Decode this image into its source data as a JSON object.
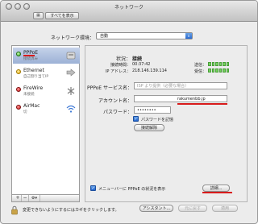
{
  "window": {
    "title": "ネットワーク",
    "show_all_label": "すべてを表示"
  },
  "location": {
    "label": "ネットワーク環境：",
    "value": "自動"
  },
  "services": [
    {
      "name": "PPPoE",
      "status": "接続済み",
      "state": "green",
      "icon": "phone-icon",
      "selected": true
    },
    {
      "name": "Ethernet",
      "status": "自己割り当てIP",
      "state": "yellow",
      "icon": "ethernet-icon",
      "selected": false
    },
    {
      "name": "FireWire",
      "status": "未接続",
      "state": "red",
      "icon": "firewire-icon",
      "selected": false
    },
    {
      "name": "AirMac",
      "status": "切",
      "state": "red",
      "icon": "wifi-icon",
      "selected": false
    }
  ],
  "sidebar_buttons": {
    "add": "+",
    "remove": "−",
    "gear": "⚙▾"
  },
  "detail": {
    "status_label": "状況：",
    "status_value": "接続",
    "connect_time_label": "接続時間：",
    "connect_time_value": "00:37:42",
    "ip_label": "IP アドレス：",
    "ip_value": "218.146.139.114",
    "sent_label": "送信：",
    "received_label": "受信：",
    "service_name_label": "PPPoE サービス名：",
    "service_name_placeholder": "ISP より提供（必要な場合）",
    "account_label": "アカウント名：",
    "account_value": "rakumenbb.jp",
    "password_label": "パスワード：",
    "password_value": "••••••••",
    "remember_password_label": "パスワードを記憶",
    "disconnect_button": "接続解除",
    "menu_status_label": "メニューバーに PPPoE の状況を表示",
    "advanced_button": "詳細..."
  },
  "footer": {
    "lock_text": "変更できないようにするにはカギをクリックします。",
    "assistant_button": "アシスタント...",
    "revert_button": "元に戻す",
    "apply_button": "適用"
  },
  "colors": {
    "selection": "#9cb1d6",
    "connected": "#31a01a",
    "disconnected": "#c91414",
    "checkbox": "#2364cd",
    "annotation": "#d81b1b"
  }
}
